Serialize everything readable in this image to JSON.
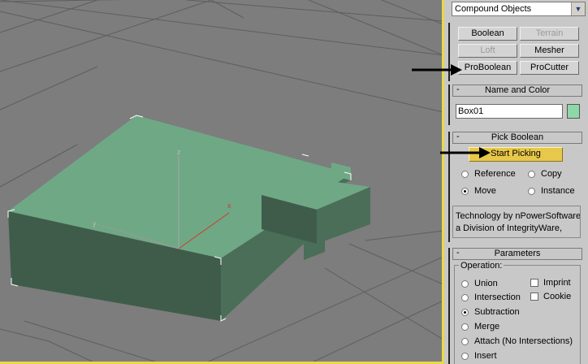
{
  "viewport": {
    "axis_labels": {
      "z": "z",
      "x": "x",
      "y": "y"
    }
  },
  "panel": {
    "category_dropdown": "Compound Objects",
    "object_type_buttons": [
      {
        "label": "Boolean",
        "enabled": true
      },
      {
        "label": "Terrain",
        "enabled": false
      },
      {
        "label": "Loft",
        "enabled": false
      },
      {
        "label": "Mesher",
        "enabled": true
      },
      {
        "label": "ProBoolean",
        "enabled": true
      },
      {
        "label": "ProCutter",
        "enabled": true
      }
    ],
    "name_and_color": {
      "title": "Name and Color",
      "collapse": "-",
      "object_name": "Box01",
      "swatch_color": "#8ed8a8"
    },
    "pick_boolean": {
      "title": "Pick Boolean",
      "collapse": "-",
      "start_button": "Start Picking",
      "start_button_color": "#e8c84a",
      "options": [
        {
          "label": "Reference",
          "selected": false
        },
        {
          "label": "Copy",
          "selected": false
        },
        {
          "label": "Move",
          "selected": true
        },
        {
          "label": "Instance",
          "selected": false
        }
      ],
      "credit_line1": "Technology by nPowerSoftware",
      "credit_line2": "a Division of IntegrityWare,"
    },
    "parameters": {
      "title": "Parameters",
      "collapse": "-",
      "group_label": "Operation:",
      "operations": [
        {
          "label": "Union",
          "selected": false
        },
        {
          "label": "Intersection",
          "selected": false
        },
        {
          "label": "Subtraction",
          "selected": true
        },
        {
          "label": "Merge",
          "selected": false
        },
        {
          "label": "Attach (No Intersections)",
          "selected": false
        },
        {
          "label": "Insert",
          "selected": false
        }
      ],
      "checkboxes": [
        {
          "label": "Imprint",
          "checked": false
        },
        {
          "label": "Cookie",
          "checked": false
        }
      ]
    }
  },
  "colors": {
    "viewport_border": "#e8d84a",
    "object_top": "#6fa885",
    "object_side": "#3f5c4b"
  }
}
